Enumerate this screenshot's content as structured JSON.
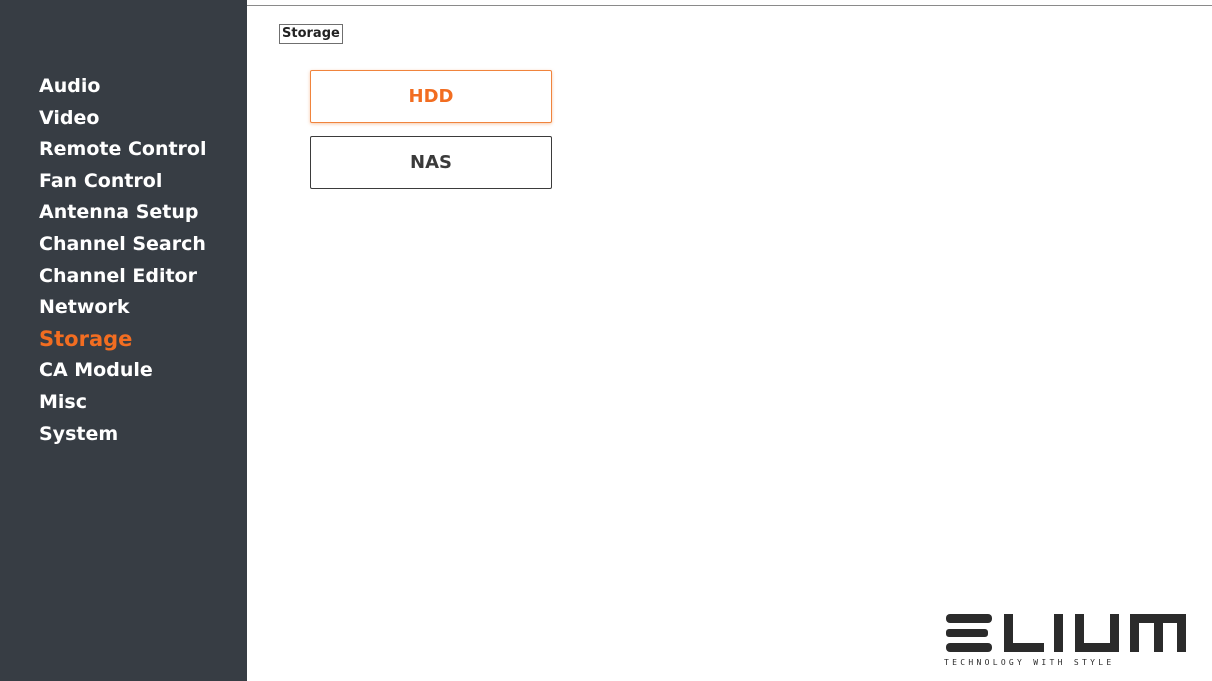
{
  "sidebar": {
    "items": [
      {
        "label": "Audio"
      },
      {
        "label": "Video"
      },
      {
        "label": "Remote Control"
      },
      {
        "label": "Fan Control"
      },
      {
        "label": "Antenna Setup"
      },
      {
        "label": "Channel Search"
      },
      {
        "label": "Channel Editor"
      },
      {
        "label": "Network"
      },
      {
        "label": "Storage"
      },
      {
        "label": "CA Module"
      },
      {
        "label": "Misc"
      },
      {
        "label": "System"
      }
    ],
    "active_item": "Storage"
  },
  "main": {
    "breadcrumb": "Storage",
    "options": [
      {
        "label": "HDD",
        "selected": true
      },
      {
        "label": "NAS",
        "selected": false
      }
    ]
  },
  "logo": {
    "wordmark": "ELIUM",
    "tagline": "TECHNOLOGY WITH STYLE"
  },
  "colors": {
    "sidebar_bg": "#373d44",
    "accent": "#f26d21",
    "text_light": "#ffffff"
  }
}
